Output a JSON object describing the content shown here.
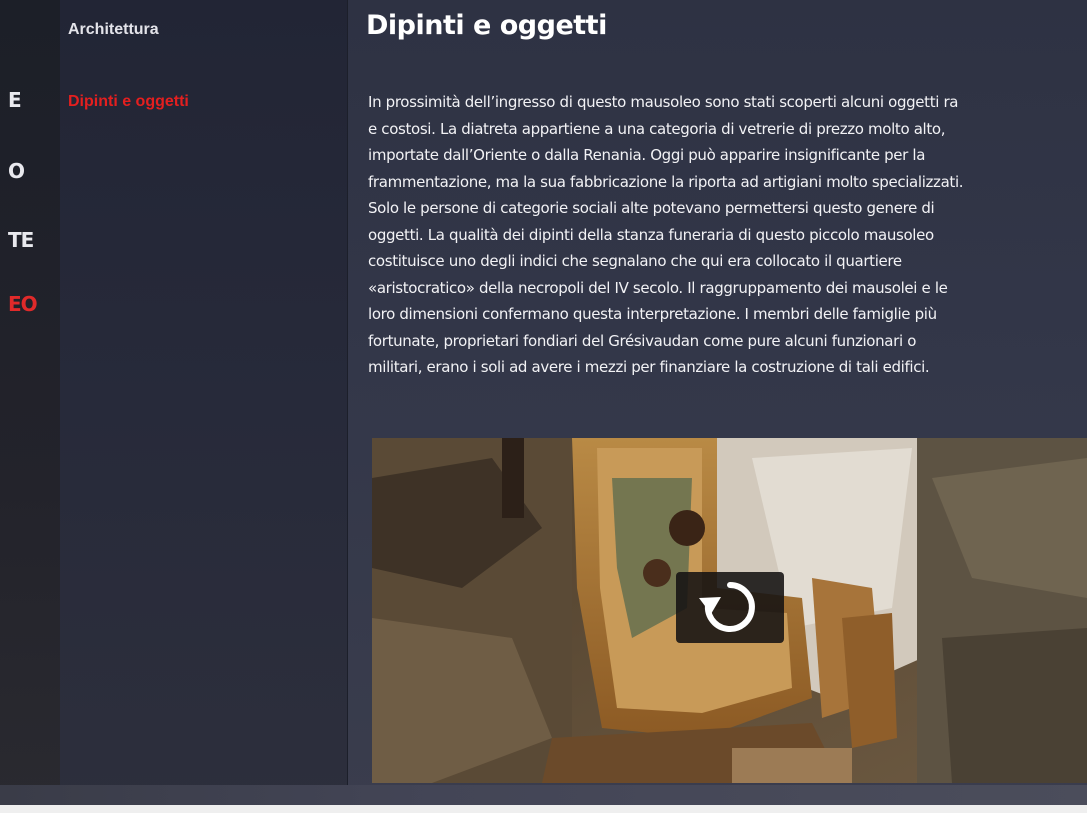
{
  "outer_menu": {
    "items": [
      {
        "label": "E",
        "active": false
      },
      {
        "label": "O",
        "active": false
      },
      {
        "label": "TE",
        "active": false
      },
      {
        "label": "EO",
        "active": true
      }
    ]
  },
  "sidebar": {
    "items": [
      {
        "label": "Architettura",
        "active": false
      },
      {
        "label": "Dipinti e oggetti",
        "active": true
      }
    ]
  },
  "main": {
    "title": "Dipinti e oggetti",
    "paragraph_lines": [
      "In prossimità dell’ingresso di questo mausoleo sono stati scoperti alcuni oggetti ra",
      "e costosi. La diatreta appartiene a una categoria di vetrerie di prezzo molto alto,",
      "importate dall’Oriente o dalla Renania. Oggi può apparire insignificante per la",
      "frammentazione, ma la sua fabbricazione la riporta ad artigiani molto specializzati.",
      "Solo le persone di categorie sociali alte potevano permettersi questo genere di",
      "oggetti. La qualità dei dipinti della stanza funeraria di questo piccolo mausoleo",
      "costituisce uno degli indici che segnalano che qui era collocato il quartiere",
      "«aristocratico» della necropoli del IV secolo. Il raggruppamento dei mausolei e le",
      "loro dimensioni confermano questa interpretazione. I membri delle famiglie più",
      "fortunate, proprietari fondiari del Grésivaudan come pure alcuni funzionari o",
      "militari, erano i soli ad avere i mezzi per finanziare la costruzione di tali edifici."
    ],
    "media": {
      "icon": "replay-icon"
    }
  },
  "colors": {
    "accent_red": "#e41f1f",
    "sidebar_bg": "#252838",
    "main_bg": "#333749",
    "text": "#f2f2f5"
  }
}
